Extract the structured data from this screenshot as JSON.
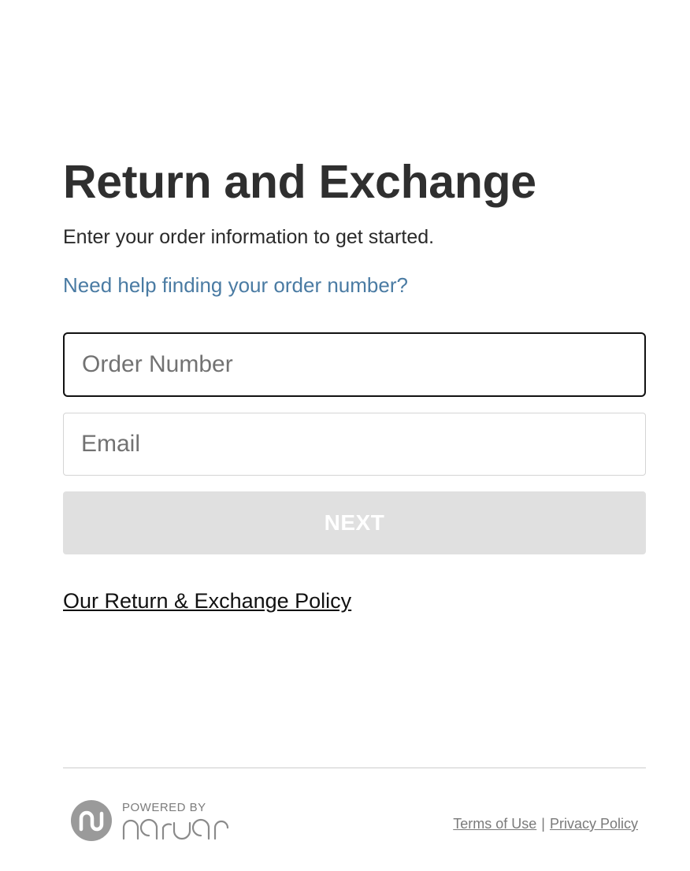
{
  "header": {
    "title": "Return and Exchange",
    "subtitle": "Enter your order information to get started.",
    "help_link": "Need help finding your order number?"
  },
  "form": {
    "order_number": {
      "value": "",
      "placeholder": "Order Number"
    },
    "email": {
      "value": "",
      "placeholder": "Email"
    },
    "next_label": "NEXT"
  },
  "policy_link": "Our Return & Exchange Policy",
  "footer": {
    "powered_by": "POWERED BY",
    "brand": "narvar",
    "logo_icon": "narvar-logo-icon",
    "terms": "Terms of Use",
    "separator": "|",
    "privacy": "Privacy Policy"
  },
  "colors": {
    "title": "#2f2f2f",
    "link": "#4a7ba3",
    "button_disabled": "#e0e0e0",
    "logo": "#9a9a9a"
  }
}
